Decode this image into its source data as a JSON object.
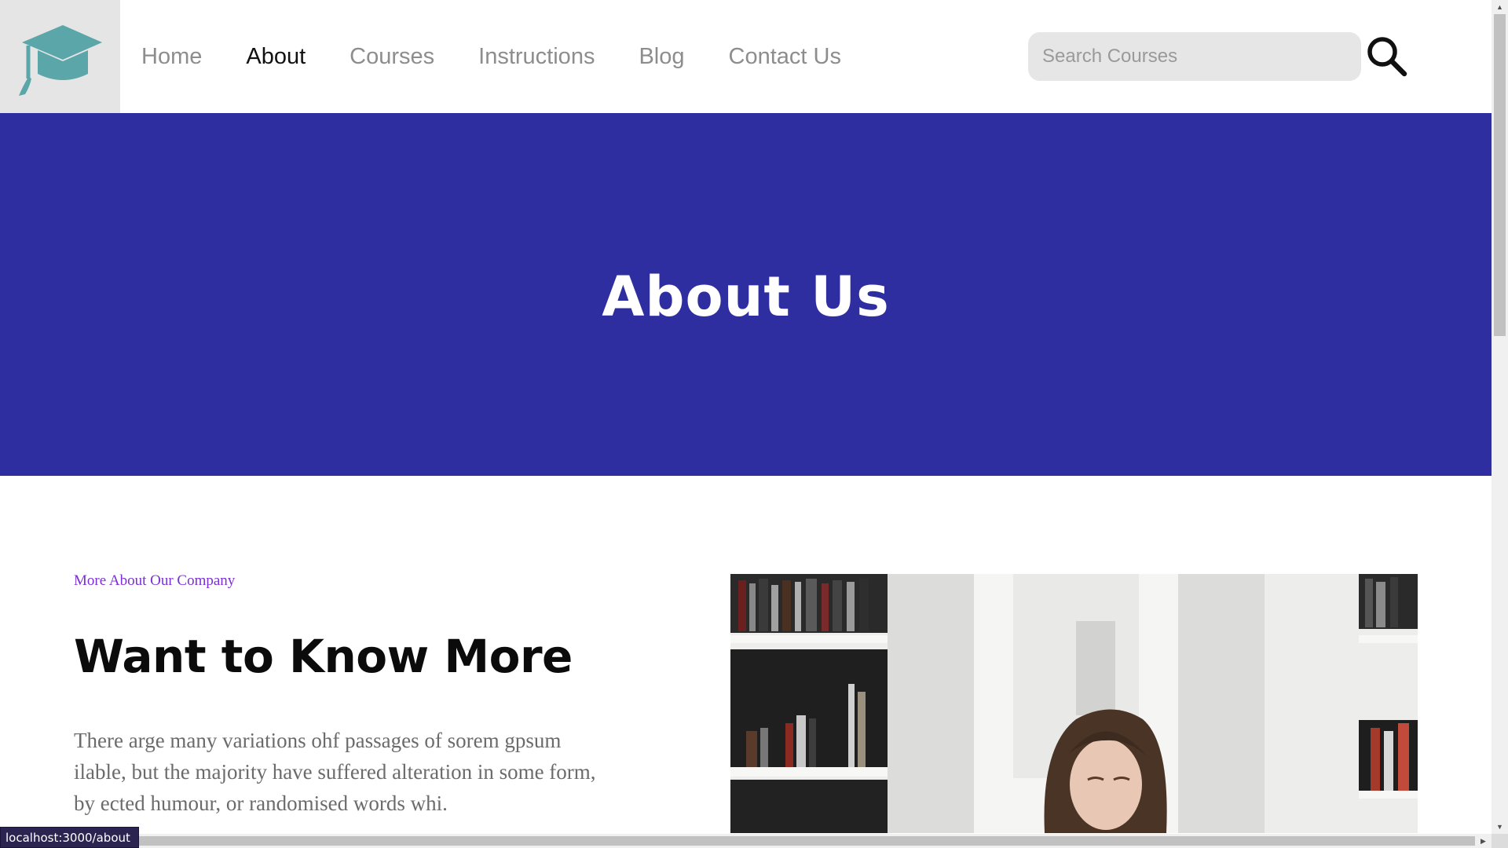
{
  "header": {
    "logo_icon": "graduation-cap-icon",
    "nav": [
      {
        "label": "Home",
        "active": false
      },
      {
        "label": "About",
        "active": true
      },
      {
        "label": "Courses",
        "active": false
      },
      {
        "label": "Instructions",
        "active": false
      },
      {
        "label": "Blog",
        "active": false
      },
      {
        "label": "Contact Us",
        "active": false
      }
    ],
    "search": {
      "placeholder": "Search Courses",
      "value": "",
      "icon": "search-icon"
    }
  },
  "hero": {
    "title": "About Us",
    "background": "#2f2ea1"
  },
  "about": {
    "eyebrow": "More About Our Company",
    "title": "Want to Know More",
    "body": "There arge many variations ohf passages of sorem gpsum ilable, but the majority have suffered alteration in some form, by ected humour, or randomised words whi.",
    "image": "photo of a girl studying in front of bookshelves"
  },
  "browser": {
    "status_url": "localhost:3000/about"
  },
  "colors": {
    "accent": "#2f2ea1",
    "eyebrow": "#7b2fd6",
    "logo_teal": "#5aa6a8",
    "nav_inactive": "#8d8d8d"
  }
}
